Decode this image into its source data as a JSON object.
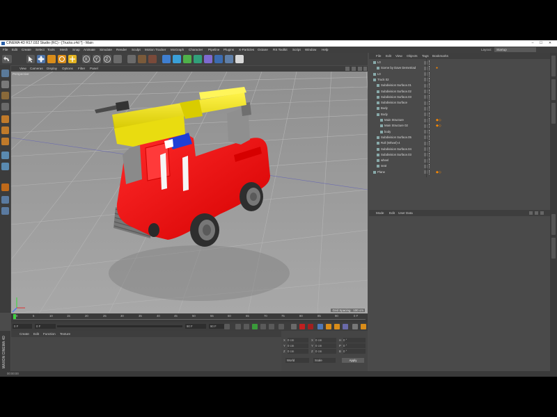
{
  "window": {
    "title": "CINEMA 4D R17.032 Studio (RC) - [Trucks.c4d *] - Main",
    "btn_min": "–",
    "btn_max": "☐",
    "btn_close": "✕"
  },
  "menubar": {
    "items": [
      "File",
      "Edit",
      "Create",
      "Select",
      "Tools",
      "Mesh",
      "Snap",
      "Animate",
      "Simulate",
      "Render",
      "Sculpt",
      "Motion Tracker",
      "MoGraph",
      "Character",
      "Pipeline",
      "Plugins",
      "X-Particles",
      "Octane",
      "RS Toolkit",
      "Script",
      "Window",
      "Help"
    ],
    "layout_label": "Layout:",
    "layout_value": "Startup"
  },
  "viewport": {
    "menu": [
      "View",
      "Cameras",
      "Display",
      "Options",
      "Filter",
      "Panel"
    ],
    "camera_label": "Perspective",
    "grid_spacing": "Grid Spacing : 100 cm"
  },
  "timeline": {
    "ticks": [
      "0",
      "5",
      "10",
      "15",
      "20",
      "25",
      "30",
      "35",
      "40",
      "45",
      "50",
      "55",
      "60",
      "65",
      "70",
      "75",
      "80",
      "85",
      "90"
    ],
    "end_frame": "0 F",
    "current_frame": "0 F",
    "min_field": "0 F",
    "max_field": "90 F",
    "preview_max": "90 F"
  },
  "material_manager": {
    "menu": [
      "Create",
      "Edit",
      "Function",
      "Texture"
    ]
  },
  "coordinates": {
    "rows": [
      {
        "a": "X",
        "b": "0 cm",
        "c": "X",
        "d": "0 cm",
        "e": "H",
        "f": "0 °"
      },
      {
        "a": "Y",
        "b": "0 cm",
        "c": "Y",
        "d": "0 cm",
        "e": "P",
        "f": "0 °"
      },
      {
        "a": "Z",
        "b": "0 cm",
        "c": "Z",
        "d": "0 cm",
        "e": "B",
        "f": "0 °"
      }
    ],
    "mode1": "World",
    "mode2": "Scale",
    "apply": "Apply"
  },
  "brand": "MAXON CINEMA 4D",
  "status": "00:00:00",
  "object_manager": {
    "menu": [
      "File",
      "Edit",
      "View",
      "Objects",
      "Tags",
      "Bookmarks"
    ],
    "rows": [
      {
        "name": "L0",
        "indent": 0
      },
      {
        "name": "Scene by Dave Demetriad",
        "indent": 1
      },
      {
        "name": "L0",
        "indent": 0
      },
      {
        "name": "Truck 02",
        "indent": 0
      },
      {
        "name": "Subdivision Surface.01",
        "indent": 1
      },
      {
        "name": "Subdivision Surface.02",
        "indent": 1
      },
      {
        "name": "Subdivision Surface.03",
        "indent": 1
      },
      {
        "name": "Subdivision Surface",
        "indent": 1
      },
      {
        "name": "Body",
        "indent": 1
      },
      {
        "name": "Body",
        "indent": 1
      },
      {
        "name": "Main Structure",
        "indent": 2
      },
      {
        "name": "Main Structure 02",
        "indent": 2
      },
      {
        "name": "body",
        "indent": 2
      },
      {
        "name": "Subdivision Surface.05",
        "indent": 1
      },
      {
        "name": "Roll (Wheel)-4",
        "indent": 1
      },
      {
        "name": "Subdivision Surface.04",
        "indent": 1
      },
      {
        "name": "Subdivision Surface.03",
        "indent": 1
      },
      {
        "name": "wheel",
        "indent": 1
      },
      {
        "name": "seat",
        "indent": 1
      },
      {
        "name": "Plane",
        "indent": 0
      }
    ]
  },
  "attribute_manager": {
    "menu": [
      "Mode",
      "Edit",
      "User Data"
    ]
  },
  "colors": {
    "truck_red": "#ff0a0a",
    "ladder_yellow": "#f2e400",
    "accent_orange": "#ff8a00"
  }
}
